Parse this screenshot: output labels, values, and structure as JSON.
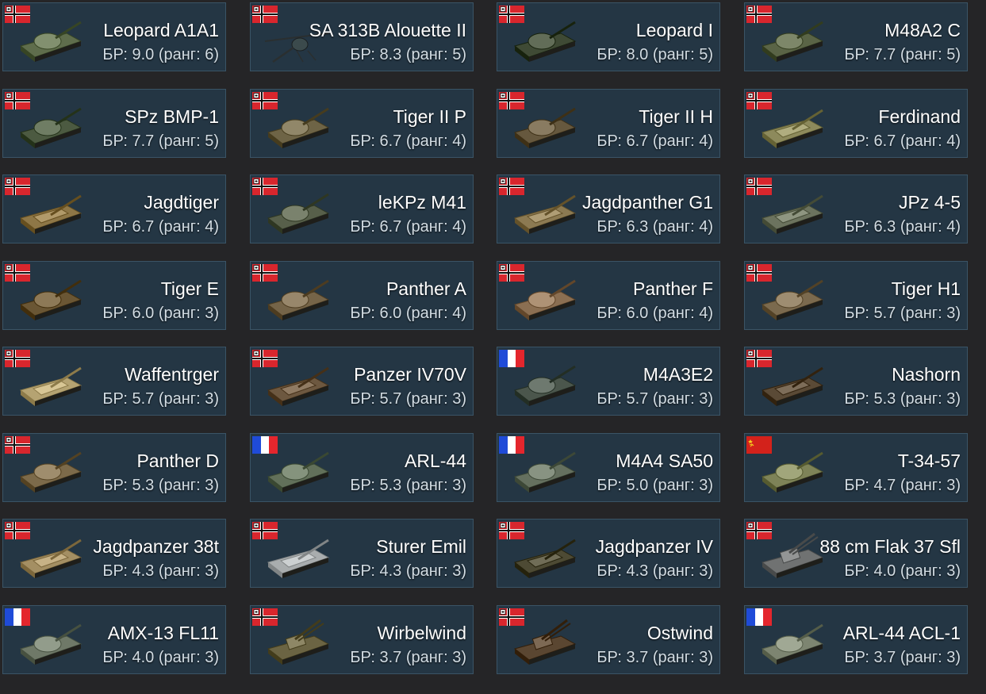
{
  "vehicles": [
    {
      "name": "Leopard A1A1",
      "br": "9.0",
      "rank": "6",
      "nation": "germany",
      "kind": "tank",
      "camo": "#5f6d4c"
    },
    {
      "name": "SA 313B Alouette II",
      "br": "8.3",
      "rank": "5",
      "nation": "germany",
      "kind": "helicopter",
      "camo": "#3b4a4c"
    },
    {
      "name": "Leopard I",
      "br": "8.0",
      "rank": "5",
      "nation": "germany",
      "kind": "tank",
      "camo": "#3f4a35"
    },
    {
      "name": "M48A2 C",
      "br": "7.7",
      "rank": "5",
      "nation": "germany",
      "kind": "tank",
      "camo": "#5a6446"
    },
    {
      "name": "SPz BMP-1",
      "br": "7.7",
      "rank": "5",
      "nation": "germany",
      "kind": "ifv",
      "camo": "#4c5a41"
    },
    {
      "name": "Tiger II P",
      "br": "6.7",
      "rank": "4",
      "nation": "germany",
      "kind": "tank",
      "camo": "#6e6446"
    },
    {
      "name": "Tiger II H",
      "br": "6.7",
      "rank": "4",
      "nation": "germany",
      "kind": "tank",
      "camo": "#66583e"
    },
    {
      "name": "Ferdinand",
      "br": "6.7",
      "rank": "4",
      "nation": "germany",
      "kind": "td",
      "camo": "#8d8a5c"
    },
    {
      "name": "Jagdtiger",
      "br": "6.7",
      "rank": "4",
      "nation": "germany",
      "kind": "td",
      "camo": "#8e7747"
    },
    {
      "name": "leKPz M41",
      "br": "6.7",
      "rank": "4",
      "nation": "germany",
      "kind": "tank",
      "camo": "#575f4a"
    },
    {
      "name": "Jagdpanther G1",
      "br": "6.3",
      "rank": "4",
      "nation": "germany",
      "kind": "td",
      "camo": "#8c7a52"
    },
    {
      "name": "JPz 4-5",
      "br": "6.3",
      "rank": "4",
      "nation": "germany",
      "kind": "td",
      "camo": "#6c735e"
    },
    {
      "name": "Tiger E",
      "br": "6.0",
      "rank": "3",
      "nation": "germany",
      "kind": "tank",
      "camo": "#6a5634"
    },
    {
      "name": "Panther A",
      "br": "6.0",
      "rank": "4",
      "nation": "germany",
      "kind": "tank",
      "camo": "#756448"
    },
    {
      "name": "Panther F",
      "br": "6.0",
      "rank": "4",
      "nation": "germany",
      "kind": "tank",
      "camo": "#8b6f52"
    },
    {
      "name": "Tiger H1",
      "br": "5.7",
      "rank": "3",
      "nation": "germany",
      "kind": "tank",
      "camo": "#7b6a4e"
    },
    {
      "name": "Waffentrger",
      "br": "5.7",
      "rank": "3",
      "nation": "germany",
      "kind": "td",
      "camo": "#b5a372"
    },
    {
      "name": "Panzer IV70V",
      "br": "5.7",
      "rank": "3",
      "nation": "germany",
      "kind": "td",
      "camo": "#6d5840"
    },
    {
      "name": "M4A3E2",
      "br": "5.7",
      "rank": "3",
      "nation": "france",
      "kind": "tank",
      "camo": "#4b564c"
    },
    {
      "name": "Nashorn",
      "br": "5.3",
      "rank": "3",
      "nation": "germany",
      "kind": "spg",
      "camo": "#5a4a36"
    },
    {
      "name": "Panther D",
      "br": "5.3",
      "rank": "3",
      "nation": "germany",
      "kind": "tank",
      "camo": "#7c6a4a"
    },
    {
      "name": "ARL-44",
      "br": "5.3",
      "rank": "3",
      "nation": "france",
      "kind": "tank",
      "camo": "#62705a"
    },
    {
      "name": "M4A4 SA50",
      "br": "5.0",
      "rank": "3",
      "nation": "france",
      "kind": "tank",
      "camo": "#65705f"
    },
    {
      "name": "T-34-57",
      "br": "4.7",
      "rank": "3",
      "nation": "ussr",
      "kind": "tank",
      "camo": "#7e8358"
    },
    {
      "name": "Jagdpanzer 38t",
      "br": "4.3",
      "rank": "3",
      "nation": "germany",
      "kind": "td",
      "camo": "#a48f63"
    },
    {
      "name": "Sturer Emil",
      "br": "4.3",
      "rank": "3",
      "nation": "germany",
      "kind": "spg",
      "camo": "#a9adae"
    },
    {
      "name": "Jagdpanzer IV",
      "br": "4.3",
      "rank": "3",
      "nation": "germany",
      "kind": "td",
      "camo": "#4d4a34"
    },
    {
      "name": "88 cm Flak 37 Sfl",
      "br": "4.0",
      "rank": "3",
      "nation": "germany",
      "kind": "spaa",
      "camo": "#707272"
    },
    {
      "name": "AMX-13 FL11",
      "br": "4.0",
      "rank": "3",
      "nation": "france",
      "kind": "tank",
      "camo": "#6f7968"
    },
    {
      "name": "Wirbelwind",
      "br": "3.7",
      "rank": "3",
      "nation": "germany",
      "kind": "spaa",
      "camo": "#6b6443"
    },
    {
      "name": "Ostwind",
      "br": "3.7",
      "rank": "3",
      "nation": "germany",
      "kind": "spaa",
      "camo": "#5a4631"
    },
    {
      "name": "ARL-44 ACL-1",
      "br": "3.7",
      "rank": "3",
      "nation": "france",
      "kind": "tank",
      "camo": "#7d8571"
    }
  ],
  "labels": {
    "br_prefix": "БР: ",
    "rank_prefix": " (ранг: ",
    "rank_suffix": ")"
  },
  "colors": {
    "card_bg": "#243644",
    "card_border": "#3a5466",
    "page_bg": "#252527"
  }
}
